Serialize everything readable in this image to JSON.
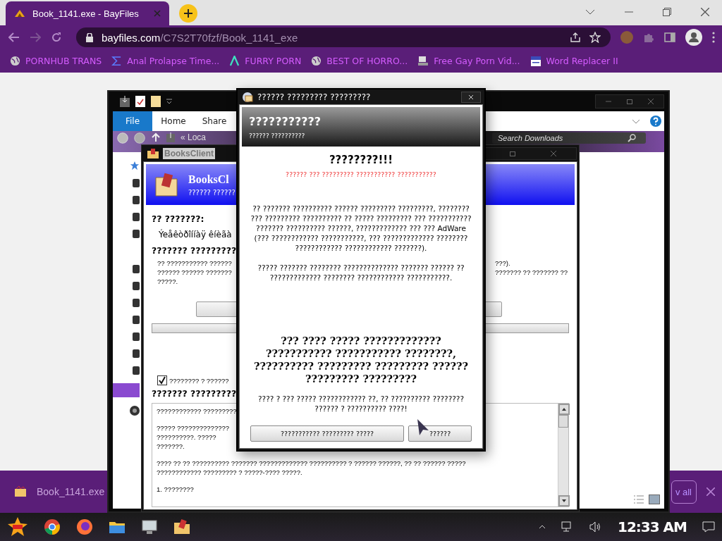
{
  "browser": {
    "tab_title": "Book_1141.exe - BayFiles",
    "url_domain": "bayfiles.com",
    "url_path": "/C7S2T70fzf/Book_1141_exe",
    "bookmarks": [
      {
        "label": "PORNHUB TRANS",
        "kind": "globe"
      },
      {
        "label": "Anal Prolapse Time...",
        "kind": "sigma"
      },
      {
        "label": "FURRY PORN",
        "kind": "lambda"
      },
      {
        "label": "BEST OF HORRO...",
        "kind": "globe"
      },
      {
        "label": "Free Gay Porn Vid...",
        "kind": "computer"
      },
      {
        "label": "Word Replacer II",
        "kind": "wr"
      }
    ]
  },
  "explorer": {
    "ribbon_tabs": [
      {
        "label": "File",
        "selected": true
      },
      {
        "label": "Home",
        "selected": false
      },
      {
        "label": "Share",
        "selected": false
      }
    ],
    "address_prefix": "«",
    "address": "Loca",
    "search_placeholder": "Search Downloads"
  },
  "books_client": {
    "title": "BooksClient",
    "header_title": "BooksCl",
    "header_subtitle": "?????? ??????",
    "field_label": "?? ???????:",
    "field_value": "Ýeåêòðîííàÿ êíèãà",
    "section_heading": "??????? ?????????",
    "info_left": [
      "?? ??????????? ??????",
      "?????? ?????? ???????",
      "?????."
    ],
    "info_right": [
      "???).",
      "??????? ?? ??????? ??"
    ],
    "checkbox": {
      "label": "???????? ? ??????",
      "checked": true
    },
    "license_heading": "??????? ?????????",
    "license_paragraphs": [
      [
        "???????????? ?????????"
      ],
      [
        "????? ??????????????",
        "??????????. ?????",
        "???????."
      ],
      [
        "???? ?? ?? ?????????? ??????? ????????????? ?????????? ? ?????? ??????, ?? ?? ?????? ?????",
        "???????????? ????????? ? ?????-???? ?????."
      ],
      [
        "1. ????????"
      ]
    ]
  },
  "dialog": {
    "title": "?????? ????????? ?????????",
    "header_title": "???????????",
    "header_subtitle": "?????? ??????????",
    "heading": "????????!!!",
    "warning": "?????? ??? ????????? ??????????? ???????????",
    "paragraphs": [
      "?? ??????? ?????????? ?????? ????????? ?????????, ???????? ??? ????????? ?????????? ?? ????? ????????? ??? ??????????? ??????? ?????????? ??????, ????????????? ??? ??? AdWare (??? ???????????? ???????????, ??? ????????????? ???????? ???????????? ???????????? ???????).",
      "????? ??????? ???????? ?????????????? ??????? ?????? ?? ????????????? ???????? ???????????? ???????????."
    ],
    "bold_paragraph": "??? ???? ????? ????????????? ??????????? ??????????? ????????, ?????????? ????????? ????????? ?????? ????????? ?????????",
    "closing": "???? ? ??? ????? ???????????? ??, ?? ?????????? ???????? ?????? ? ?????????? ????!",
    "buttons": [
      "??????????? ????????? ?????",
      "??????"
    ]
  },
  "download_bar": {
    "file_name": "Book_1141.exe",
    "show_all": "v all"
  },
  "taskbar": {
    "clock": "12:33 AM"
  }
}
